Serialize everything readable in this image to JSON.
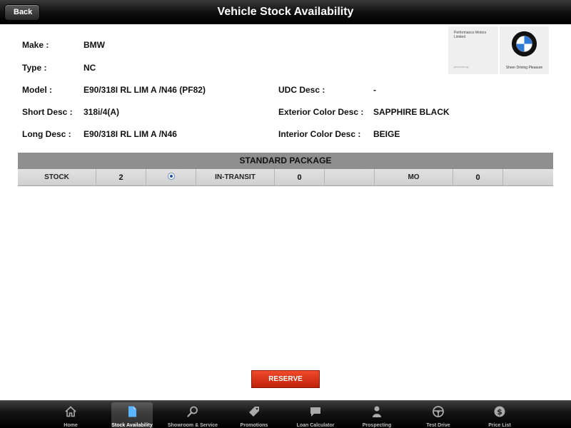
{
  "header": {
    "back_label": "Back",
    "title": "Vehicle Stock Availability"
  },
  "vehicle": {
    "make_label": "Make :",
    "make": "BMW",
    "type_label": "Type :",
    "type": "NC",
    "model_label": "Model :",
    "model": "E90/318I RL LIM A /N46 (PF82)",
    "short_desc_label": "Short Desc :",
    "short_desc": "318i/4(A)",
    "long_desc_label": "Long Desc :",
    "long_desc": "E90/318I RL LIM A /N46",
    "udc_desc_label": "UDC Desc :",
    "udc_desc": "-",
    "exterior_label": "Exterior Color Desc :",
    "exterior": "SAPPHIRE BLACK",
    "interior_label": "Interior Color Desc :",
    "interior": "BEIGE"
  },
  "logo": {
    "dealer_name": "Performance Motors Limited",
    "dealer_url": "pml.com.sg",
    "tagline": "Sheer Driving Pleasure"
  },
  "package": {
    "title": "STANDARD PACKAGE",
    "stock_label": "STOCK",
    "stock_value": "2",
    "in_transit_label": "IN-TRANSIT",
    "in_transit_value": "0",
    "mo_label": "MO",
    "mo_value": "0"
  },
  "actions": {
    "reserve_label": "RESERVE"
  },
  "tabbar": {
    "active_tab": "Stock Availability",
    "tabs": [
      {
        "label": "Home",
        "icon": "home-icon"
      },
      {
        "label": "Stock Availability",
        "icon": "document-icon"
      },
      {
        "label": "Showroom & Service",
        "icon": "search-icon"
      },
      {
        "label": "Promotions",
        "icon": "tag-icon"
      },
      {
        "label": "Loan Calculator",
        "icon": "speech-bubble-icon"
      },
      {
        "label": "Prospecting",
        "icon": "person-icon"
      },
      {
        "label": "Test Drive",
        "icon": "steering-wheel-icon"
      },
      {
        "label": "Price List",
        "icon": "dollar-icon"
      }
    ]
  },
  "colors": {
    "accent_red": "#d8300f",
    "header_black": "#000000",
    "package_gray": "#8f8f8f"
  }
}
